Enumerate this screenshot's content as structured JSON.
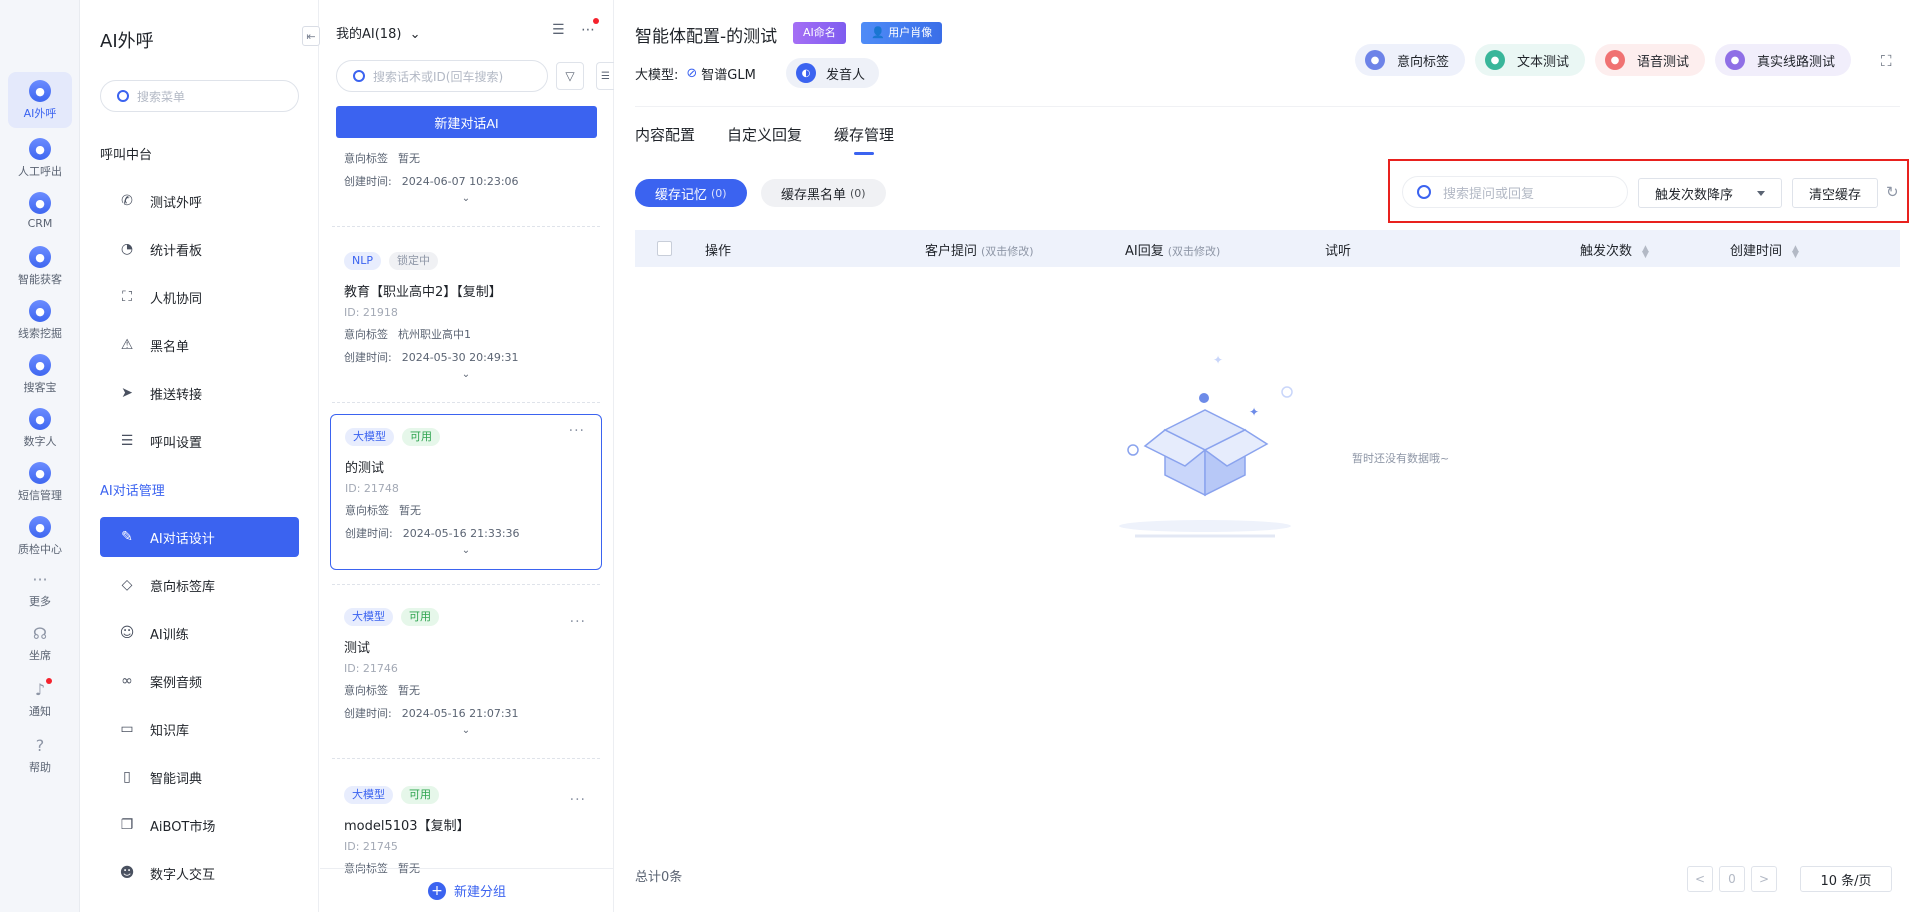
{
  "rail": {
    "items": [
      {
        "label": "AI外呼",
        "icon": "ai-call-icon"
      },
      {
        "label": "人工呼出",
        "icon": "manual-call-icon"
      },
      {
        "label": "CRM",
        "icon": "crm-icon"
      },
      {
        "label": "智能获客",
        "icon": "acquire-icon"
      },
      {
        "label": "线索挖掘",
        "icon": "leads-icon"
      },
      {
        "label": "搜客宝",
        "icon": "search-customer-icon"
      },
      {
        "label": "数字人",
        "icon": "digital-human-icon"
      },
      {
        "label": "短信管理",
        "icon": "sms-icon"
      },
      {
        "label": "质检中心",
        "icon": "quality-icon"
      },
      {
        "label": "更多",
        "icon": "more-icon"
      },
      {
        "label": "坐席",
        "icon": "headset-icon"
      },
      {
        "label": "通知",
        "icon": "bell-icon"
      },
      {
        "label": "帮助",
        "icon": "help-icon"
      }
    ]
  },
  "menu": {
    "title": "AI外呼",
    "collapse_glyph": "⇤",
    "search_placeholder": "搜索菜单",
    "group1": "呼叫中台",
    "group1_items": [
      {
        "label": "测试外呼",
        "glyph": "✆"
      },
      {
        "label": "统计看板",
        "glyph": "◔"
      },
      {
        "label": "人机协同",
        "glyph": "⛶"
      },
      {
        "label": "黑名单",
        "glyph": "⚠"
      },
      {
        "label": "推送转接",
        "glyph": "➤"
      },
      {
        "label": "呼叫设置",
        "glyph": "☰"
      }
    ],
    "group2": "AI对话管理",
    "group2_items": [
      {
        "label": "AI对话设计",
        "glyph": "✎",
        "active": true
      },
      {
        "label": "意向标签库",
        "glyph": "◇"
      },
      {
        "label": "AI训练",
        "glyph": "☺"
      },
      {
        "label": "案例音频",
        "glyph": "∞"
      },
      {
        "label": "知识库",
        "glyph": "▭"
      },
      {
        "label": "智能词典",
        "glyph": "▯"
      },
      {
        "label": "AiBOT市场",
        "glyph": "❐"
      },
      {
        "label": "数字人交互",
        "glyph": "☻"
      }
    ]
  },
  "list": {
    "header": "我的AI(18)",
    "header_caret": "⌄",
    "tools_glyph": "☰ ⋯",
    "filter_glyph": "▽",
    "side_glyph": "☰",
    "search_placeholder": "搜索话术或ID(回车搜索)",
    "new_button": "新建对话AI",
    "top_card": {
      "tag_label": "意向标签",
      "tag_value": "暂无",
      "created_label": "创建时间:",
      "created_value": "2024-06-07 10:23:06"
    },
    "cards": [
      {
        "tags": [
          {
            "text": "NLP",
            "style": "blue"
          },
          {
            "text": "锁定中",
            "style": "gray"
          }
        ],
        "name": "教育【职业高中2】【复制】",
        "id": "ID: 21918",
        "tag_label": "意向标签",
        "tag_value": "杭州职业高中1",
        "created_label": "创建时间:",
        "created_value": "2024-05-30 20:49:31",
        "more": ""
      },
      {
        "tags": [
          {
            "text": "大模型",
            "style": "blue"
          },
          {
            "text": "可用",
            "style": "green"
          }
        ],
        "name": "的测试",
        "id": "ID: 21748",
        "tag_label": "意向标签",
        "tag_value": "暂无",
        "created_label": "创建时间:",
        "created_value": "2024-05-16 21:33:36",
        "more": "···",
        "selected": true
      },
      {
        "tags": [
          {
            "text": "大模型",
            "style": "blue"
          },
          {
            "text": "可用",
            "style": "green"
          }
        ],
        "name": "测试",
        "id": "ID: 21746",
        "tag_label": "意向标签",
        "tag_value": "暂无",
        "created_label": "创建时间:",
        "created_value": "2024-05-16 21:07:31",
        "more": "···"
      },
      {
        "tags": [
          {
            "text": "大模型",
            "style": "blue"
          },
          {
            "text": "可用",
            "style": "green"
          }
        ],
        "name": "model5103【复制】",
        "id": "ID: 21745",
        "tag_label": "意向标签",
        "tag_value": "暂无",
        "created_label": "",
        "created_value": "",
        "more": "···"
      }
    ],
    "footer": "新建分组"
  },
  "main": {
    "title": "智能体配置-的测试",
    "badge_ai": "AI命名",
    "badge_user": "用户肖像",
    "model_label": "大模型:",
    "model_value": "智谱GLM",
    "speaker": "发音人",
    "actions": [
      {
        "label": "意向标签",
        "color": "#eef1fb",
        "icon_color": "#6d83e8",
        "icon": "tag-icon"
      },
      {
        "label": "文本测试",
        "color": "#eaf7f4",
        "icon_color": "#39b69a",
        "icon": "doc-icon"
      },
      {
        "label": "语音测试",
        "color": "#fdeeee",
        "icon_color": "#f07272",
        "icon": "voice-icon"
      },
      {
        "label": "真实线路测试",
        "color": "#f1eefb",
        "icon_color": "#8f6fe6",
        "icon": "line-icon"
      }
    ],
    "fullscreen_glyph": "⛶",
    "tabs": [
      {
        "label": "内容配置"
      },
      {
        "label": "自定义回复"
      },
      {
        "label": "缓存管理",
        "active": true
      }
    ],
    "subtabs": [
      {
        "label": "缓存记忆",
        "count": "(0)",
        "active": true
      },
      {
        "label": "缓存黑名单",
        "count": "(0)"
      }
    ],
    "cache_search_placeholder": "搜索提问或回复",
    "sort_value": "触发次数降序",
    "clear_button": "清空缓存",
    "refresh_glyph": "↻",
    "table": {
      "columns": [
        {
          "label": "操作",
          "hint": ""
        },
        {
          "label": "客户提问",
          "hint": "(双击修改)"
        },
        {
          "label": "AI回复",
          "hint": "(双击修改)"
        },
        {
          "label": "试听",
          "hint": ""
        },
        {
          "label": "触发次数",
          "hint": "",
          "sortable": true
        },
        {
          "label": "创建时间",
          "hint": "",
          "sortable": true
        }
      ]
    },
    "empty_text": "暂时还没有数据哦~",
    "total": "总计0条",
    "pager": {
      "prev": "<",
      "page": "0",
      "next": ">",
      "page_size": "10 条/页"
    },
    "colors": {
      "accent": "#3b63f0",
      "highlight": "#e8211e"
    }
  }
}
